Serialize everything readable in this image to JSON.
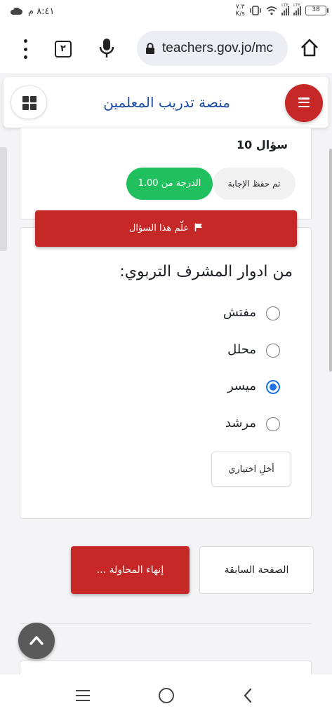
{
  "status_bar": {
    "time": "٨:٤١ م",
    "speed_value": "٧.٣",
    "speed_unit": "K/s",
    "signal_1_label": "LTE",
    "signal_2_label": "LTE",
    "battery": "38"
  },
  "browser": {
    "tab_count": "٢",
    "url": "teachers.gov.jo/mc"
  },
  "site": {
    "title": "منصة تدريب المعلمين"
  },
  "question": {
    "number_prefix": "سؤال",
    "number": "10",
    "status": "تم حفظ الإجابة",
    "grade": "الدرجة من 1.00",
    "flag_label": "علّم هذا السؤال",
    "text": "من ادوار المشرف التربوي:",
    "options": [
      {
        "label": "مفتش",
        "selected": false
      },
      {
        "label": "محلل",
        "selected": false
      },
      {
        "label": "ميسر",
        "selected": true
      },
      {
        "label": "مرشد",
        "selected": false
      }
    ],
    "clear_label": "أخلِ اختياري"
  },
  "navigation": {
    "previous_label": "الصفحة السابقة",
    "finish_label": "إنهاء المحاولة ..."
  },
  "colors": {
    "accent_red": "#c62828",
    "success_green": "#20c05f",
    "title_blue": "#1a4ba3",
    "radio_blue": "#1a73e8"
  },
  "icons": {
    "header_left": "grid-icon",
    "header_right": "hamburger-menu-icon",
    "flag": "flag-icon",
    "scroll_top": "chevron-up-icon"
  }
}
